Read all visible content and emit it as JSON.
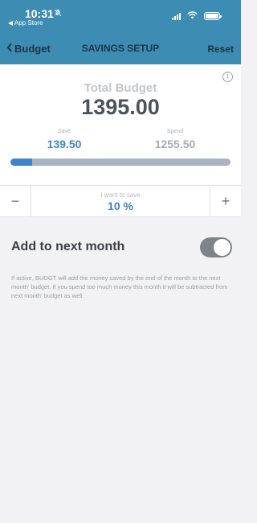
{
  "status_bar": {
    "time": "10:31",
    "back_app": "◀ App Store"
  },
  "nav": {
    "back_label": "Budget",
    "title": "SAVINGS SETUP",
    "reset_label": "Reset"
  },
  "budget": {
    "total_label": "Total Budget",
    "total_value": "1395.00",
    "save_label": "Save",
    "save_value": "139.50",
    "spend_label": "Spend",
    "spend_value": "1255.50",
    "progress_fraction": 0.1
  },
  "stepper": {
    "minus": "−",
    "plus": "+",
    "label": "I want to save",
    "value": "10 %"
  },
  "carry_over": {
    "label": "Add to next month",
    "enabled": true,
    "description": "If active, BUDGT will add the money saved by the end of the month to the next month' budget. If you spend too much money this month it will be subtracted from next month' budget as well."
  },
  "colors": {
    "header": "#3d8cb3",
    "accent": "#3f84c8",
    "progress_track": "#a9b3c1",
    "toggle_on": "#7d8388"
  }
}
